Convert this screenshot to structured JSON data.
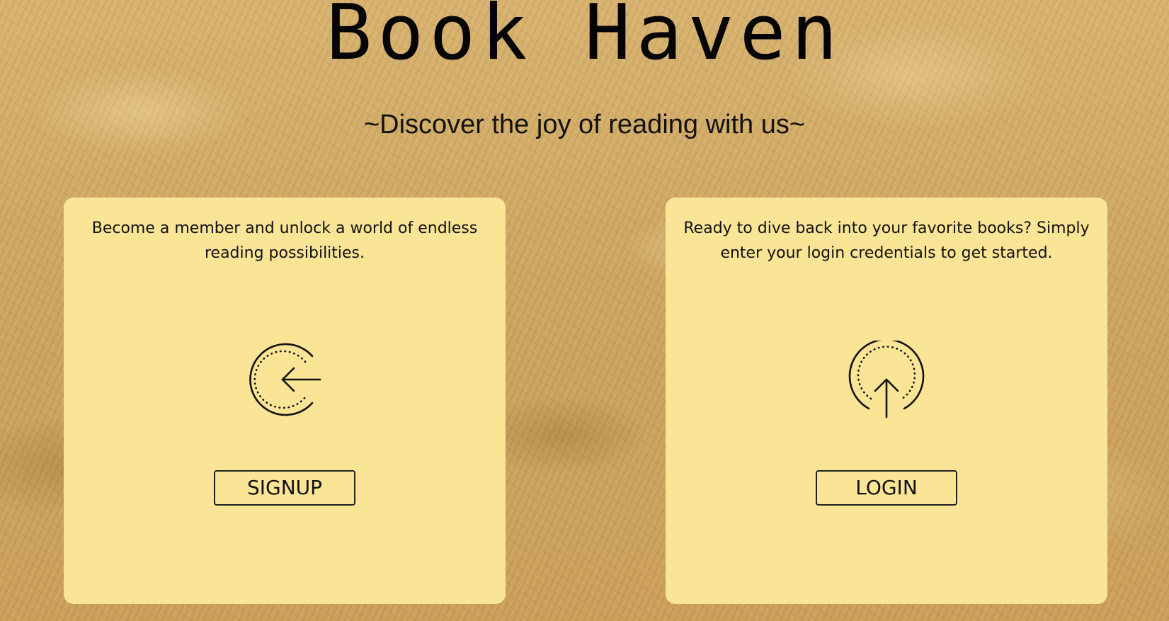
{
  "header": {
    "title": "Book Haven",
    "tagline": "~Discover the joy of reading with us~"
  },
  "cards": {
    "signup": {
      "text": "Become a member and unlock a world of endless reading possibilities.",
      "icon": "signup-arrow-left-circle-icon",
      "button_label": "SIGNUP"
    },
    "login": {
      "text": "Ready to dive back into your favorite books? Simply enter your login credentials to get started.",
      "icon": "login-arrow-up-circle-icon",
      "button_label": "LOGIN"
    }
  },
  "colors": {
    "card_background": "#fae597",
    "page_background": "#cfa661",
    "text": "#111111"
  }
}
